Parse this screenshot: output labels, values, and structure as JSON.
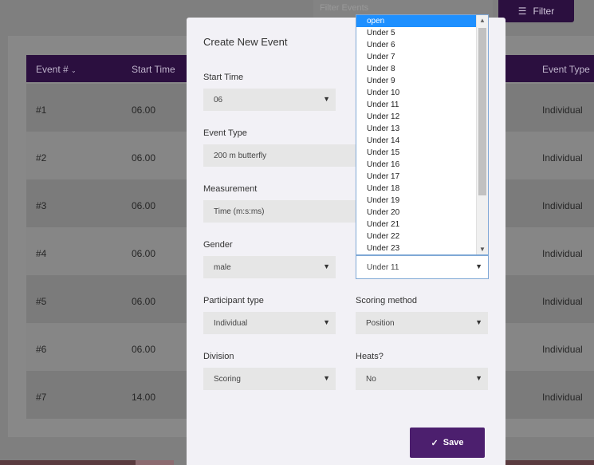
{
  "toolbar": {
    "filter_placeholder": "Filter Events",
    "filter_button_label": "Filter"
  },
  "table": {
    "headers": {
      "event_num": "Event #",
      "start_time": "Start Time",
      "event_type": "Event Type"
    },
    "rows": [
      {
        "num": "#1",
        "time": "06.00",
        "type": "Individual"
      },
      {
        "num": "#2",
        "time": "06.00",
        "type": "Individual"
      },
      {
        "num": "#3",
        "time": "06.00",
        "type": "Individual"
      },
      {
        "num": "#4",
        "time": "06.00",
        "type": "Individual"
      },
      {
        "num": "#5",
        "time": "06.00",
        "type": "Individual"
      },
      {
        "num": "#6",
        "time": "06.00",
        "type": "Individual"
      },
      {
        "num": "#7",
        "time": "14.00",
        "type": "Individual"
      }
    ]
  },
  "modal": {
    "title": "Create New Event",
    "start_time": {
      "label": "Start Time",
      "value": "06"
    },
    "event_type": {
      "label": "Event Type",
      "value": "200 m butterfly"
    },
    "measurement": {
      "label": "Measurement",
      "value": "Time (m:s:ms)"
    },
    "gender": {
      "label": "Gender",
      "value": "male"
    },
    "age_group": {
      "value": "Under 11"
    },
    "participant_type": {
      "label": "Participant type",
      "value": "Individual"
    },
    "scoring_method": {
      "label": "Scoring method",
      "value": "Position"
    },
    "division": {
      "label": "Division",
      "value": "Scoring"
    },
    "heats": {
      "label": "Heats?",
      "value": "No"
    },
    "save_label": "Save"
  },
  "age_dropdown": {
    "options": [
      "open",
      "Under 5",
      "Under 6",
      "Under 7",
      "Under 8",
      "Under 9",
      "Under 10",
      "Under 11",
      "Under 12",
      "Under 13",
      "Under 14",
      "Under 15",
      "Under 16",
      "Under 17",
      "Under 18",
      "Under 19",
      "Under 20",
      "Under 21",
      "Under 22",
      "Under 23"
    ],
    "highlighted": "open"
  },
  "icons": {
    "filter": "filter-list-icon",
    "check": "checkmark-icon",
    "arrow": "chevron-down-icon"
  },
  "colors": {
    "brand_purple": "#4c1f6e",
    "highlight_blue": "#1e90ff"
  }
}
